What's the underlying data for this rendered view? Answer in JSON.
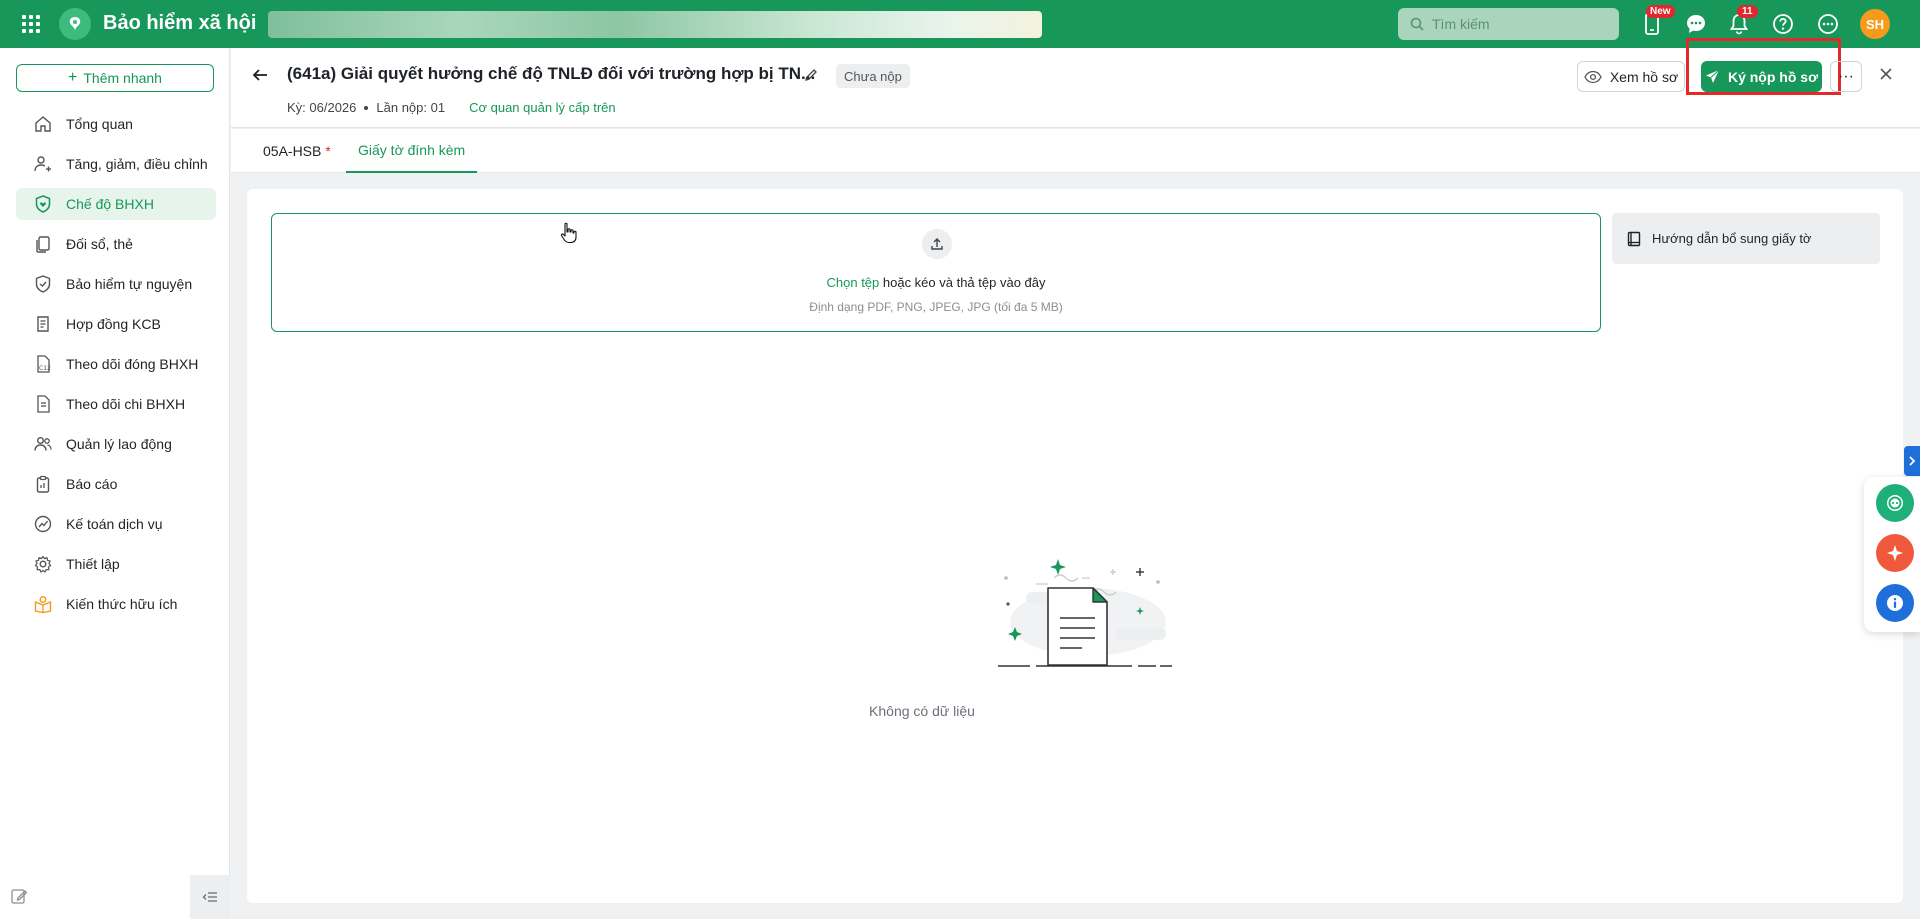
{
  "app": {
    "title": "Bảo hiểm xã hội"
  },
  "topbar": {
    "search_placeholder": "Tìm kiếm",
    "new_badge": "New",
    "notification_count": "11",
    "avatar_initials": "SH",
    "brand_color": "#17975a"
  },
  "sidebar": {
    "quick_add_label": "Thêm nhanh",
    "items": [
      {
        "label": "Tổng quan",
        "icon": "home-icon"
      },
      {
        "label": "Tăng, giảm, điều chỉnh",
        "icon": "user-adjust-icon"
      },
      {
        "label": "Chế độ BHXH",
        "icon": "shield-heart-icon",
        "active": true
      },
      {
        "label": "Đối sổ, thẻ",
        "icon": "cards-icon"
      },
      {
        "label": "Bảo hiểm tự nguyện",
        "icon": "shield-icon"
      },
      {
        "label": "Hợp đồng KCB",
        "icon": "contract-icon"
      },
      {
        "label": "Theo dõi đóng BHXH",
        "icon": "c12-document-icon"
      },
      {
        "label": "Theo dõi chi BHXH",
        "icon": "document-money-icon"
      },
      {
        "label": "Quản lý lao động",
        "icon": "users-icon"
      },
      {
        "label": "Báo cáo",
        "icon": "clipboard-icon"
      },
      {
        "label": "Kế toán dịch vụ",
        "icon": "chart-circle-icon"
      },
      {
        "label": "Thiết lập",
        "icon": "gear-icon"
      },
      {
        "label": "Kiến thức hữu ích",
        "icon": "lightbulb-book-icon"
      }
    ]
  },
  "header": {
    "title": "(641a) Giải quyết hưởng chế độ TNLĐ đối với trường hợp bị TN...",
    "status": "Chưa nộp",
    "period": "Kỳ: 06/2026",
    "submission": "Lần nộp: 01",
    "agency_link": "Cơ quan quản lý cấp trên",
    "view_button": "Xem hồ sơ",
    "sign_button": "Ký nộp hồ sơ",
    "more_button": "···"
  },
  "tabs": [
    {
      "label": "05A-HSB",
      "required": "*"
    },
    {
      "label": "Giấy tờ đính kèm",
      "active": true
    }
  ],
  "upload": {
    "pick_label": "Chọn tệp",
    "drop_label": " hoặc kéo và thả tệp vào đây",
    "hint": "Định dạng PDF, PNG, JPEG, JPG (tối đa 5 MB)",
    "guide_label": "Hướng dẫn bổ sung giấy tờ"
  },
  "empty": {
    "text": "Không có dữ liệu"
  }
}
